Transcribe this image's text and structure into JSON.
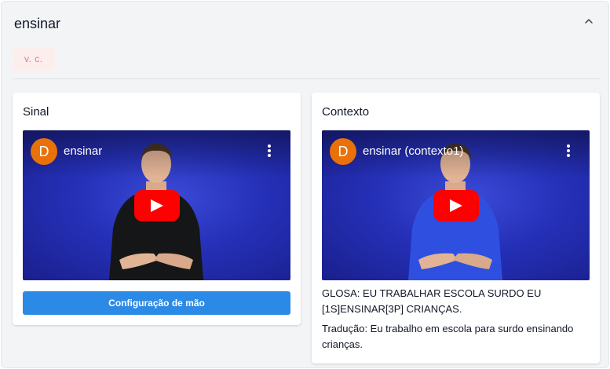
{
  "section": {
    "title": "ensinar",
    "badge": "v. c."
  },
  "sinal": {
    "title": "Sinal",
    "video": {
      "channel_initial": "D",
      "title": "ensinar",
      "shirt_color": "#151617"
    },
    "config_button": "Configuração de mão"
  },
  "contexto": {
    "title": "Contexto",
    "video": {
      "channel_initial": "D",
      "title": "ensinar (contexto1)",
      "shirt_color": "#2f4fe0"
    },
    "glosa": "GLOSA: EU TRABALHAR ESCOLA SURDO EU [1S]ENSINAR[3P] CRIANÇAS.",
    "traducao": "Tradução: Eu trabalho em escola para surdo ensinando crianças."
  },
  "colors": {
    "accent_button": "#2b8ae6",
    "badge_bg": "#fdeeee",
    "badge_text": "#f27474",
    "youtube_red": "#ff0000",
    "avatar_orange": "#e8710a"
  },
  "icons": {
    "collapse": "chevron-up-icon",
    "play": "play-icon",
    "menu": "more-vertical-icon"
  }
}
